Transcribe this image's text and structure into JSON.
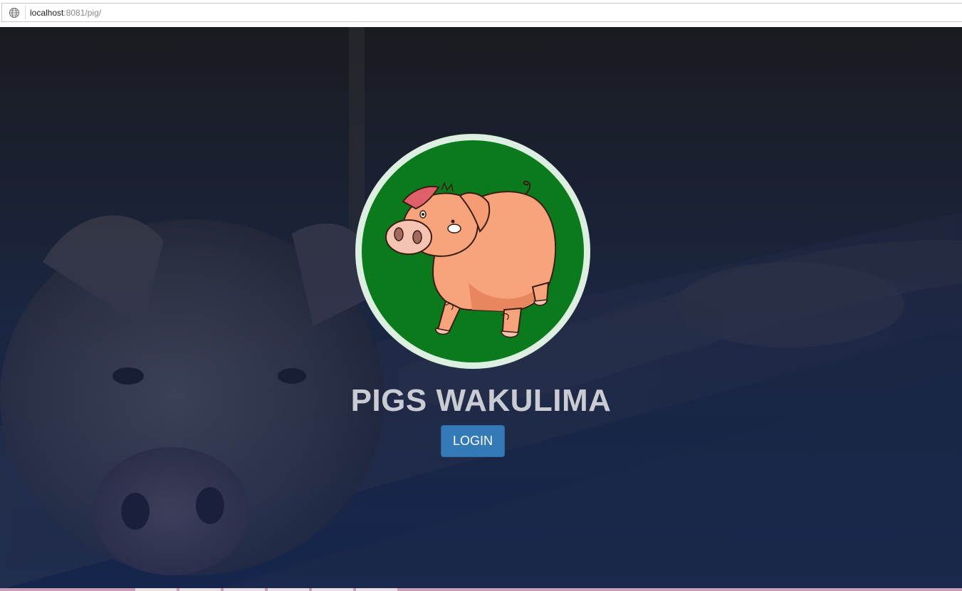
{
  "browser": {
    "url_host": "localhost",
    "url_rest": ":8081/pig/",
    "site_icon": "globe-icon"
  },
  "hero": {
    "logo_icon": "pig-logo-icon",
    "logo_ring_color": "#dcefe0",
    "logo_fill_color": "#0a7a1c",
    "title": "PIGS WAKULIMA",
    "login_label": "LOGIN",
    "login_color": "#337ab7"
  }
}
